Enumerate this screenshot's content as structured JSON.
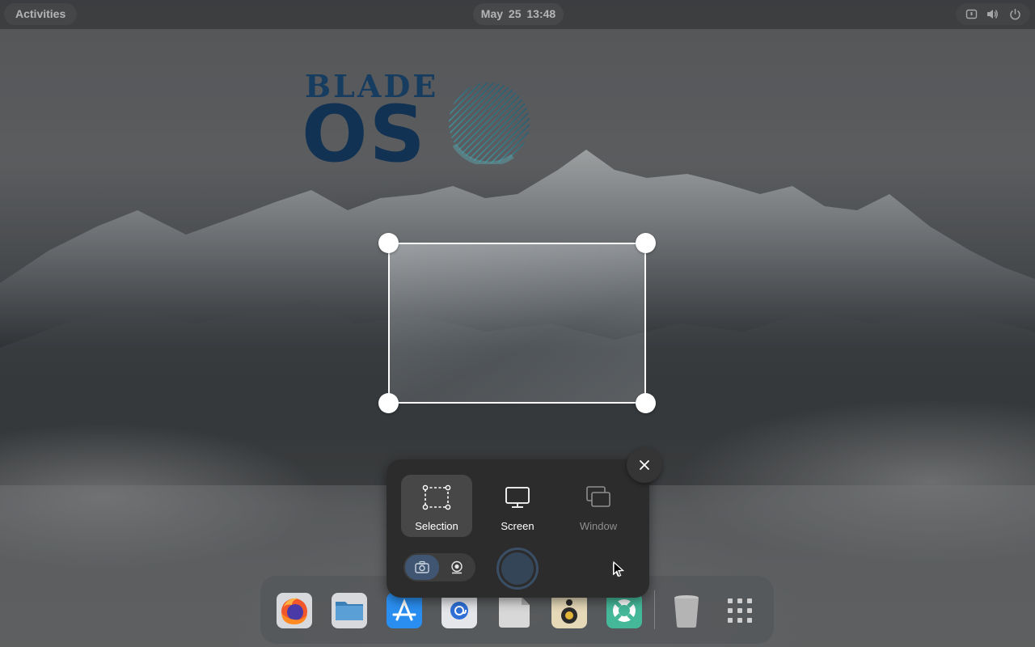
{
  "topbar": {
    "activities_label": "Activities",
    "clock": "May 25  13:48",
    "tray_icons": [
      "screen-capture-icon",
      "volume-icon",
      "power-icon"
    ]
  },
  "wallpaper": {
    "logo_line1": "BLADE",
    "logo_line2": "OS"
  },
  "screenshot_ui": {
    "modes": [
      {
        "label": "Selection",
        "icon": "selection-icon",
        "state": "active"
      },
      {
        "label": "Screen",
        "icon": "monitor-icon",
        "state": "normal"
      },
      {
        "label": "Window",
        "icon": "window-icon",
        "state": "disabled"
      }
    ],
    "capture_types": [
      {
        "icon": "camera-icon",
        "state": "active"
      },
      {
        "icon": "webcam-icon",
        "state": "inactive"
      }
    ],
    "shutter_icon": "capture-button",
    "pointer_toggle_icon": "pointer-icon",
    "close_icon": "close-icon"
  },
  "dock": {
    "apps": [
      "firefox",
      "files",
      "app-store",
      "mail",
      "text-editor",
      "rhythmbox",
      "help",
      "trash",
      "show-apps"
    ]
  },
  "colors": {
    "accent": "#3f5572",
    "panel_bg": "#2c2c2c",
    "logo_blue": "#1d4e7a",
    "logo_teal": "#4aa3b8"
  }
}
